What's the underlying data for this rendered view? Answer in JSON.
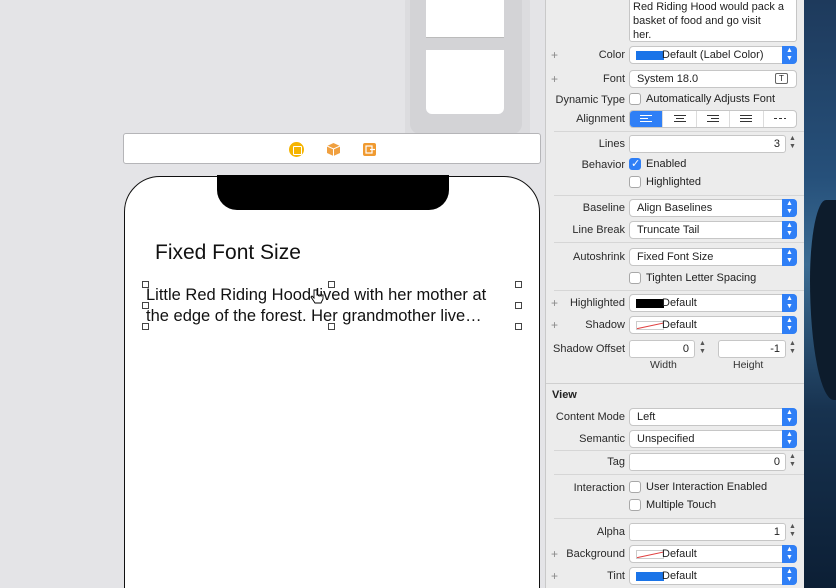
{
  "canvas": {
    "title_label": "Fixed Font Size",
    "body_lines": [
      "Little Red Riding Hood lived with her mother at",
      "the edge of the forest. Her grandmother live…"
    ],
    "scene_icons": [
      "view-controller-icon",
      "first-responder-icon",
      "exit-icon"
    ]
  },
  "inspector": {
    "text_preview": [
      "Red Riding Hood would pack a",
      "basket of food and go visit",
      "her."
    ],
    "color": {
      "label": "Color",
      "value": "Default (Label Color)",
      "swatch": "#1a74e8"
    },
    "font": {
      "label": "Font",
      "value": "System 18.0"
    },
    "dynamic_type": {
      "label": "Dynamic Type",
      "option": "Automatically Adjusts Font",
      "checked": false
    },
    "alignment": {
      "label": "Alignment",
      "selected_index": 0
    },
    "lines": {
      "label": "Lines",
      "value": "3"
    },
    "behavior": {
      "label": "Behavior",
      "enabled": "Enabled",
      "highlighted": "Highlighted"
    },
    "baseline": {
      "label": "Baseline",
      "value": "Align Baselines"
    },
    "line_break": {
      "label": "Line Break",
      "value": "Truncate Tail"
    },
    "autoshrink": {
      "label": "Autoshrink",
      "value": "Fixed Font Size",
      "tighten": "Tighten Letter Spacing"
    },
    "highlighted": {
      "label": "Highlighted",
      "value": "Default"
    },
    "shadow": {
      "label": "Shadow",
      "value": "Default"
    },
    "shadow_offset": {
      "label": "Shadow Offset",
      "width": "0",
      "height": "-1",
      "width_label": "Width",
      "height_label": "Height"
    },
    "view_section": "View",
    "content_mode": {
      "label": "Content Mode",
      "value": "Left"
    },
    "semantic": {
      "label": "Semantic",
      "value": "Unspecified"
    },
    "tag": {
      "label": "Tag",
      "value": "0"
    },
    "interaction": {
      "label": "Interaction",
      "user_interaction": "User Interaction Enabled",
      "multiple_touch": "Multiple Touch"
    },
    "alpha": {
      "label": "Alpha",
      "value": "1"
    },
    "background": {
      "label": "Background",
      "value": "Default"
    },
    "tint": {
      "label": "Tint",
      "value": "Default",
      "swatch": "#1a74e8"
    }
  }
}
